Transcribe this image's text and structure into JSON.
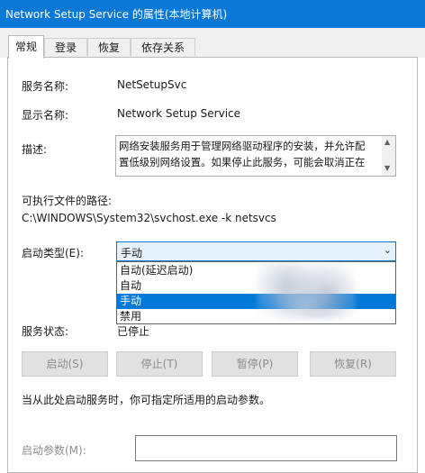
{
  "window": {
    "title": "Network Setup Service 的属性(本地计算机)"
  },
  "tabs": [
    {
      "label": "常规"
    },
    {
      "label": "登录"
    },
    {
      "label": "恢复"
    },
    {
      "label": "依存关系"
    }
  ],
  "general": {
    "service_name_label": "服务名称:",
    "service_name_value": "NetSetupSvc",
    "display_name_label": "显示名称:",
    "display_name_value": "Network Setup Service",
    "description_label": "描述:",
    "description_value": "网络安装服务用于管理网络驱动程序的安装，并允许配\n置低级别网络设置。如果停止此服务，可能会取消正在",
    "exe_path_label": "可执行文件的路径:",
    "exe_path_value": "C:\\WINDOWS\\System32\\svchost.exe -k netsvcs",
    "startup_type_label": "启动类型(E):",
    "startup_type_selected": "手动",
    "startup_type_options": [
      "自动(延迟启动)",
      "自动",
      "手动",
      "禁用"
    ],
    "service_status_label": "服务状态:",
    "service_status_value": "已停止",
    "buttons": {
      "start": "启动(S)",
      "stop": "停止(T)",
      "pause": "暂停(P)",
      "resume": "恢复(R)"
    },
    "hint_text": "当从此处启动服务时，你可指定所适用的启动参数。",
    "start_params_label": "启动参数(M):",
    "start_params_value": ""
  }
}
